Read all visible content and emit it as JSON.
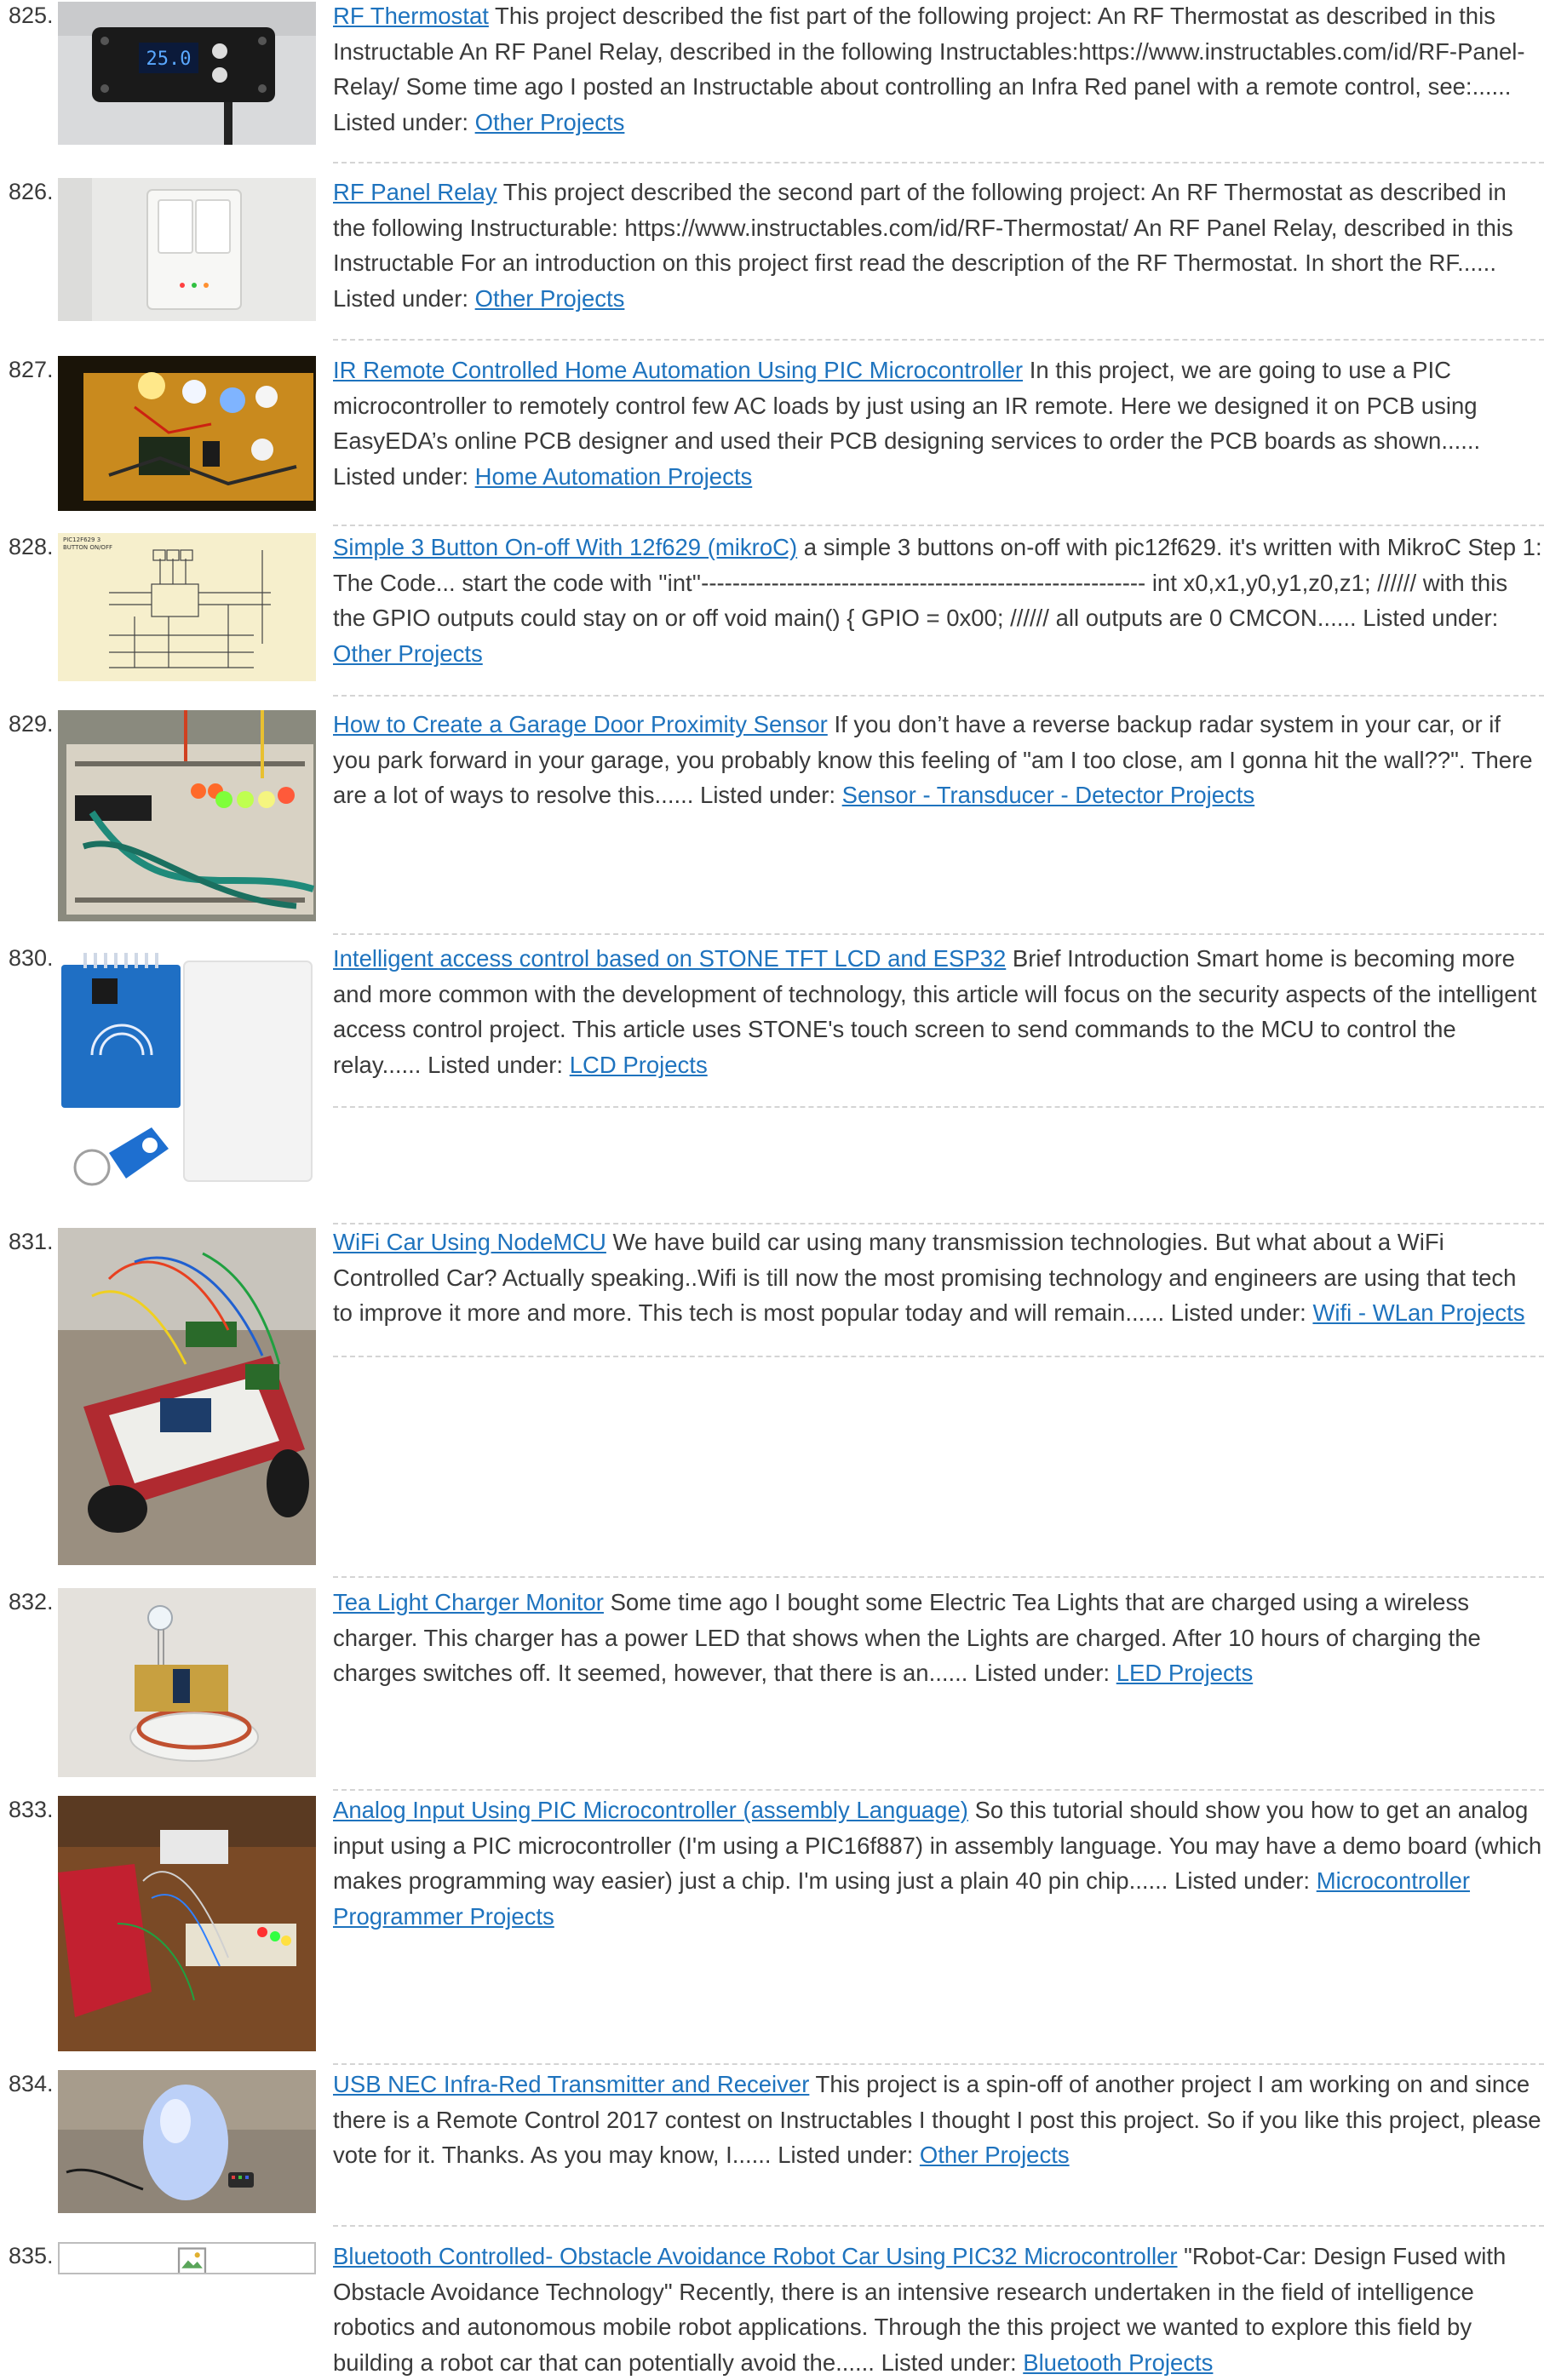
{
  "list_label": "Listed under:",
  "entries": [
    {
      "number": "825.",
      "title": "RF Thermostat",
      "description": "This project described the fist part of the following project: An RF Thermostat as described in this Instructable An RF Panel Relay, described in the following Instructables:https://www.instructables.com/id/RF-Panel-Relay/ Some time ago I posted an Instructable about controlling an Infra Red panel with a remote control, see:......",
      "category": "Other Projects",
      "thumb_text": "25.0"
    },
    {
      "number": "826.",
      "title": "RF Panel Relay",
      "description": "This project described the second part of the following project: An RF Thermostat as described in the following Instructurable: https://www.instructables.com/id/RF-Thermostat/ An RF Panel Relay, described in this Instructable For an introduction on this project first read the description of the RF Thermostat. In short the RF......",
      "category": "Other Projects"
    },
    {
      "number": "827.",
      "title": "IR Remote Controlled Home Automation Using PIC Microcontroller",
      "description": "In this project, we are going to use a PIC microcontroller to remotely control few AC loads by just using an IR remote. Here we designed it on PCB using EasyEDA’s online PCB designer and used their PCB designing services to order the PCB boards as shown......",
      "category": "Home Automation Projects"
    },
    {
      "number": "828.",
      "title": "Simple 3 Button On-off With 12f629 (mikroC)",
      "description": "a simple 3 buttons on-off with pic12f629. it's written with MikroC Step 1: The Code... start the code with ''int''--------------------------------------------------------- int x0,x1,y0,y1,z0,z1; ////// with this the GPIO outputs could stay on or off void main() { GPIO = 0x00; ////// all outputs are 0 CMCON......",
      "category": "Other Projects",
      "thumb_text": "PIC12F629 3 BUTTON ON/OFF"
    },
    {
      "number": "829.",
      "title": "How to Create a Garage Door Proximity Sensor",
      "description": "If you don’t have a reverse backup radar system in your car, or if you park forward in your garage, you probably know this feeling of \"am I too close, am I gonna hit the wall??\". There are a lot of ways to resolve this......",
      "category": "Sensor - Transducer - Detector Projects"
    },
    {
      "number": "830.",
      "title": "Intelligent access control based on STONE TFT LCD and ESP32",
      "description": "Brief Introduction Smart home is becoming more and more common with the development of technology, this article will focus on the security aspects of the intelligent access control project. This article uses STONE's touch screen to send commands to the MCU to control the relay......",
      "category": "LCD Projects"
    },
    {
      "number": "831.",
      "title": "WiFi Car Using NodeMCU",
      "description": "We have build car using many transmission technologies. But what about a WiFi Controlled Car? Actually speaking..Wifi is till now the most promising technology and engineers are using that tech to improve it more and more. This tech is most popular today and will remain......",
      "category": "Wifi - WLan Projects"
    },
    {
      "number": "832.",
      "title": "Tea Light Charger Monitor",
      "description": "Some time ago I bought some Electric Tea Lights that are charged using a wireless charger. This charger has a power LED that shows when the Lights are charged. After 10 hours of charging the charges switches off. It seemed, however, that there is an......",
      "category": "LED Projects"
    },
    {
      "number": "833.",
      "title": "Analog Input Using PIC Microcontroller (assembly Language)",
      "description": "So this tutorial should show you how to get an analog input using a PIC microcontroller (I'm using a PIC16f887) in assembly language. You may have a demo board (which makes programming way easier) just a chip. I'm using just a plain 40 pin chip......",
      "category": "Microcontroller Programmer Projects"
    },
    {
      "number": "834.",
      "title": "USB NEC Infra-Red Transmitter and Receiver",
      "description": "This project is a spin-off of another project I am working on and since there is a Remote Control 2017 contest on Instructables I thought I post this project. So if you like this project, please vote for it. Thanks. As you may know, I......",
      "category": "Other Projects"
    },
    {
      "number": "835.",
      "title": "Bluetooth Controlled- Obstacle Avoidance Robot Car Using PIC32 Microcontroller",
      "description": "\"Robot-Car: Design Fused with Obstacle Avoidance Technology\" Recently, there is an intensive research undertaken in the field of intelligence robotics and autonomous mobile robot applications. Through the this project we wanted to explore this field by building a robot car that can potentially avoid the......",
      "category": "Bluetooth Projects"
    }
  ]
}
